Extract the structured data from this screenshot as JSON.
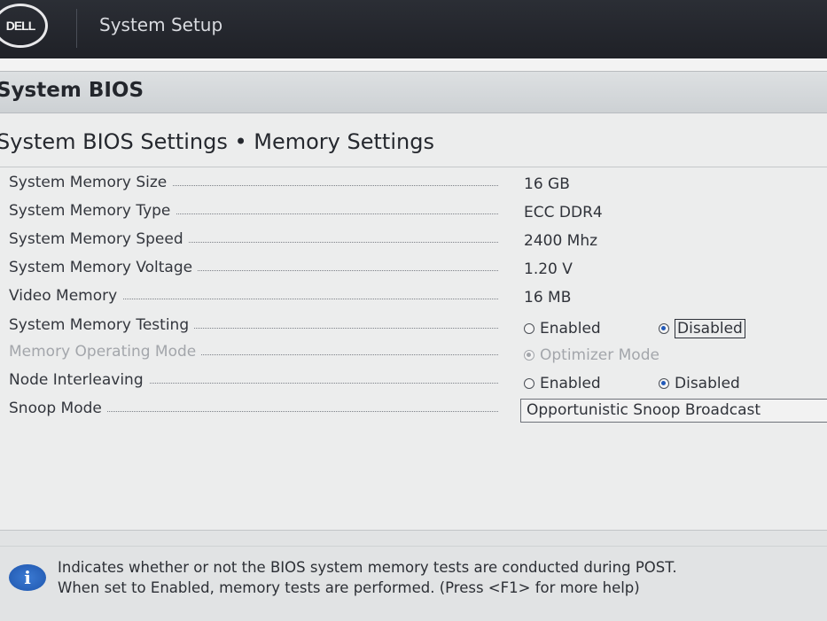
{
  "header": {
    "logo_text": "DELL",
    "app_title": "System Setup"
  },
  "section": {
    "title": "System BIOS"
  },
  "page": {
    "title": "System BIOS Settings • Memory Settings"
  },
  "settings": [
    {
      "label": "System Memory Size",
      "value": "16 GB"
    },
    {
      "label": "System Memory Type",
      "value": "ECC DDR4"
    },
    {
      "label": "System Memory Speed",
      "value": "2400 Mhz"
    },
    {
      "label": "System Memory Voltage",
      "value": "1.20 V"
    },
    {
      "label": "Video Memory",
      "value": "16 MB"
    },
    {
      "label": "System Memory Testing",
      "options": [
        "Enabled",
        "Disabled"
      ],
      "selected": "Disabled"
    },
    {
      "label": "Memory Operating Mode",
      "options": [
        "Optimizer Mode"
      ],
      "selected": "Optimizer Mode"
    },
    {
      "label": "Node Interleaving",
      "options": [
        "Enabled",
        "Disabled"
      ],
      "selected": "Disabled"
    },
    {
      "label": "Snoop Mode",
      "value": "Opportunistic Snoop Broadcast"
    }
  ],
  "help": {
    "line1": "Indicates whether or not the BIOS system memory tests are conducted during POST.",
    "line2": "When set to Enabled, memory tests are performed. (Press <F1> for more help)"
  },
  "colors": {
    "radio_selected": "#2159b8",
    "info_icon": "#2a66c4"
  },
  "icons": {
    "info": "info-icon",
    "logo": "dell-logo"
  }
}
